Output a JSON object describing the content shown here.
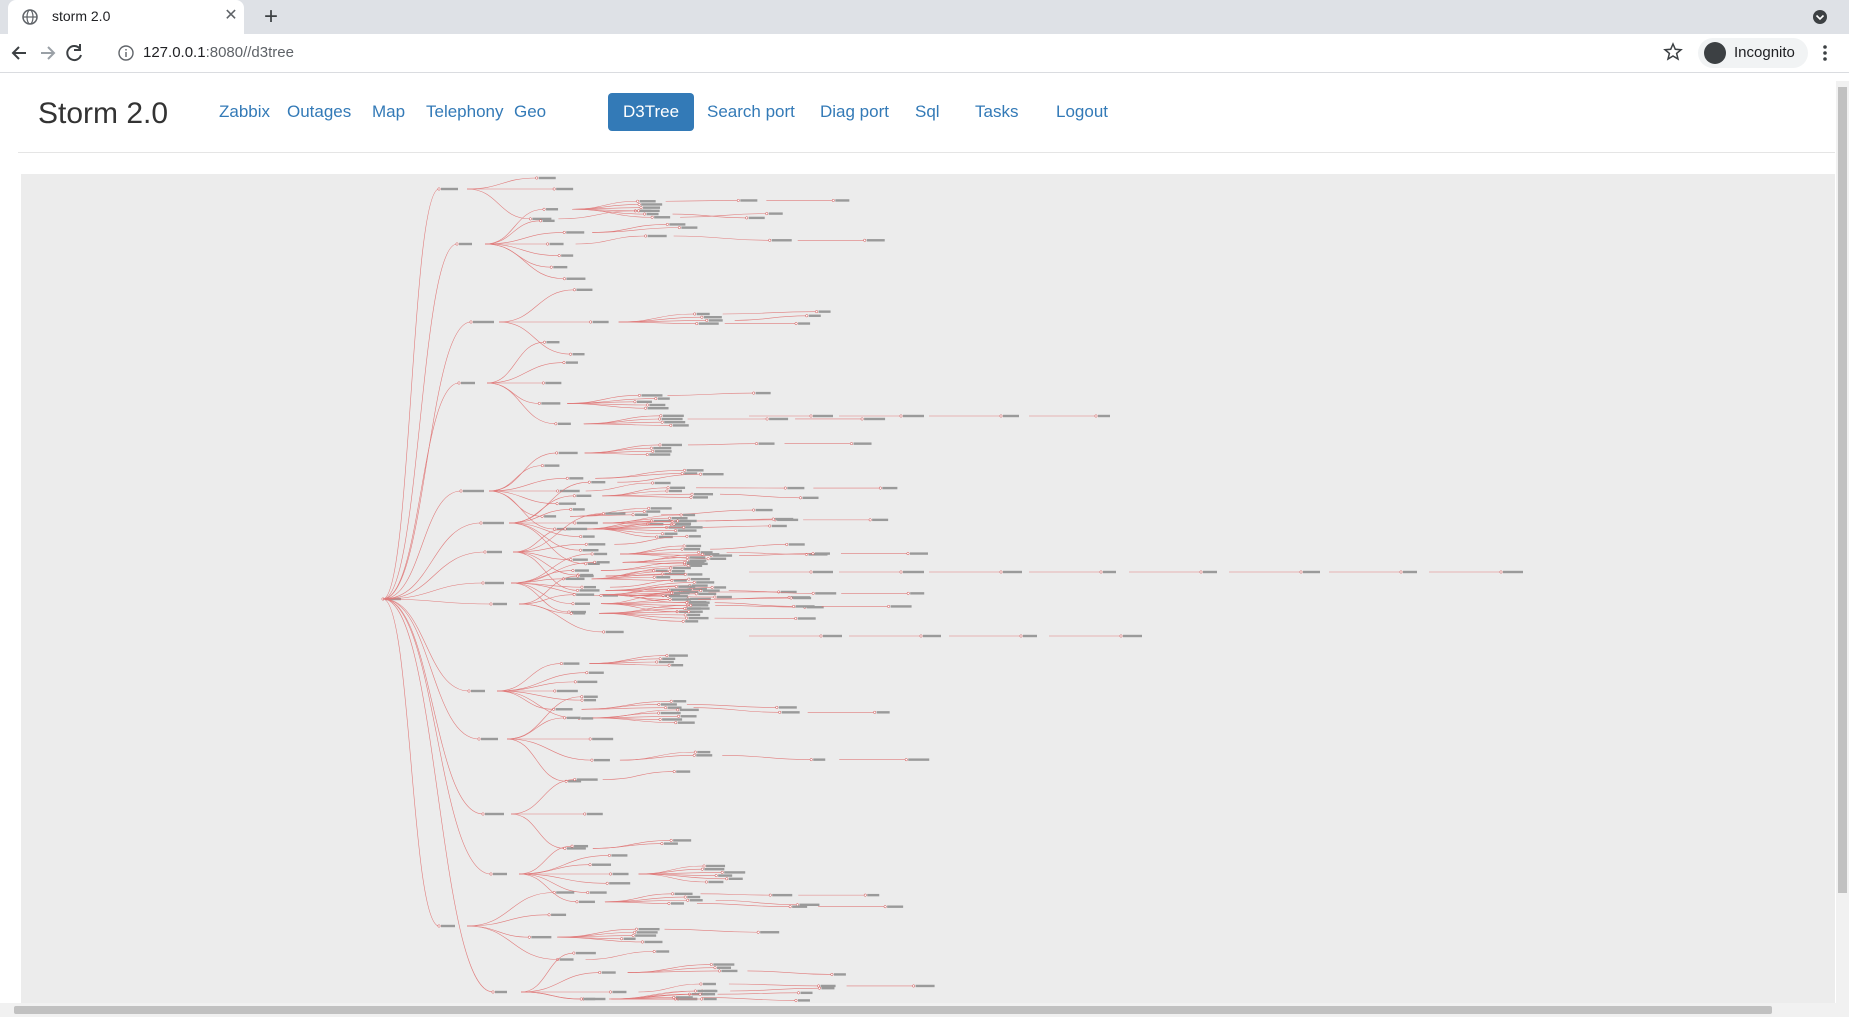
{
  "browser": {
    "tab_title": "storm 2.0",
    "url_host": "127.0.0.1",
    "url_rest": ":8080//d3tree",
    "profile_label": "Incognito"
  },
  "app": {
    "brand": "Storm 2.0",
    "nav": [
      {
        "label": "Zabbix",
        "active": false
      },
      {
        "label": "Outages",
        "active": false
      },
      {
        "label": "Map",
        "active": false
      },
      {
        "label": "Telephony",
        "active": false
      },
      {
        "label": "Geo",
        "active": false
      },
      {
        "label": "D3Tree",
        "active": true
      },
      {
        "label": "Search port",
        "active": false
      },
      {
        "label": "Diag port",
        "active": false
      },
      {
        "label": "Sql",
        "active": false
      },
      {
        "label": "Tasks",
        "active": false
      },
      {
        "label": "Logout",
        "active": false
      }
    ]
  },
  "colors": {
    "link": "#e07b7b",
    "nav_active": "#337ab7",
    "nav_text": "#337ab7",
    "tree_bg": "#ececec"
  }
}
